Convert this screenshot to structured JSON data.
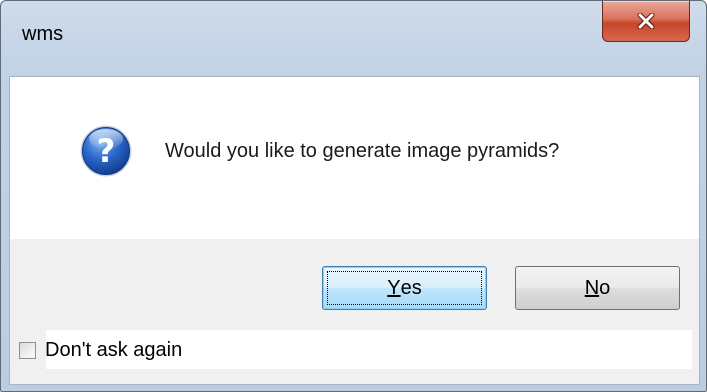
{
  "window": {
    "title": "wms"
  },
  "dialog": {
    "message": "Would you like to generate image pyramids?",
    "icon": "question-icon"
  },
  "buttons": {
    "yes_mnemonic": "Y",
    "yes_rest": "es",
    "no_mnemonic": "N",
    "no_rest": "o"
  },
  "footer": {
    "dont_ask_label": "Don't ask again",
    "dont_ask_checked": false
  },
  "colors": {
    "close_button": "#c7452a",
    "default_button_border": "#3c7fb1",
    "icon_blue": "#1f57b5"
  }
}
